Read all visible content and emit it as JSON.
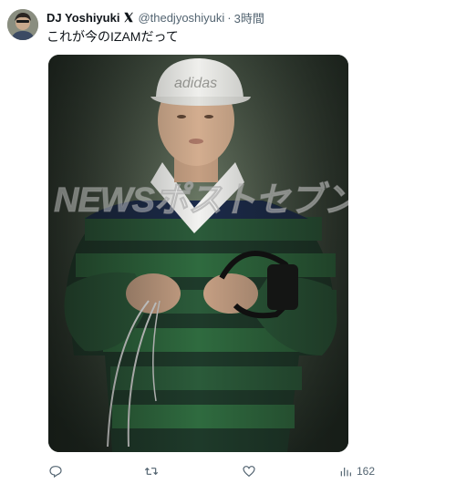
{
  "post": {
    "author": {
      "display_name": "DJ Yoshiyuki",
      "badge": "x-logo-icon",
      "handle": "@thedjyoshiyuki",
      "separator": "·",
      "time": "3時間"
    },
    "text": "これが今のIZAMだって",
    "media": {
      "watermark": "NEWSポストセブン"
    },
    "actions": {
      "reply": {
        "icon": "reply-icon"
      },
      "repost": {
        "icon": "repost-icon"
      },
      "like": {
        "icon": "heart-icon"
      },
      "views": {
        "icon": "views-icon",
        "count": "162"
      }
    }
  },
  "colors": {
    "text": "#0f1419",
    "secondary": "#536471",
    "background": "#ffffff"
  }
}
